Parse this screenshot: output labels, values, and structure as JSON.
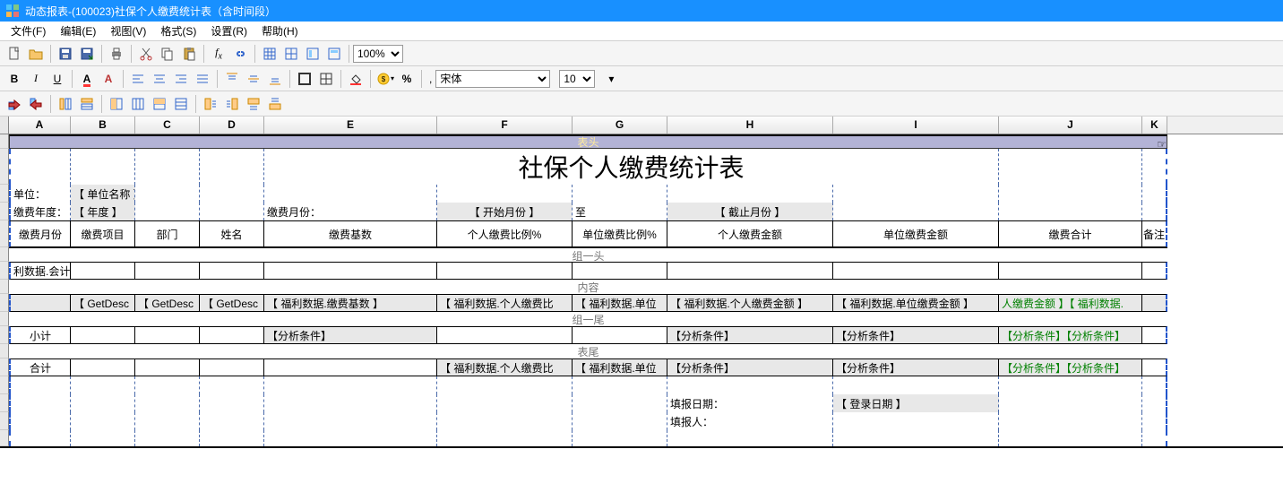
{
  "title": "动态报表-(100023)社保个人缴费统计表（含时间段）",
  "menu": [
    "文件(F)",
    "编辑(E)",
    "视图(V)",
    "格式(S)",
    "设置(R)",
    "帮助(H)"
  ],
  "zoom": "100%",
  "fontName": "宋体",
  "fontSize": "10",
  "comma": ",",
  "columns": [
    "A",
    "B",
    "C",
    "D",
    "E",
    "F",
    "G",
    "H",
    "I",
    "J",
    "K"
  ],
  "widths": [
    "cA",
    "cB",
    "cC",
    "cD",
    "cE",
    "cF",
    "cG",
    "cH",
    "cI",
    "cJ",
    "cK"
  ],
  "sections": {
    "head": "表头",
    "g1head": "组一头",
    "content": "内容",
    "g1foot": "组一尾",
    "foot": "表尾"
  },
  "docTitle": "社保个人缴费统计表",
  "labels": {
    "unit": "单位：",
    "unitName": "【 单位名称 】",
    "year": "缴费年度：",
    "yearVal": "【 年度 】",
    "month": "缴费月份：",
    "monthStart": "【 开始月份 】",
    "to": "至",
    "monthEnd": "【 截止月份 】"
  },
  "headers": {
    "A": "缴费月份",
    "B": "缴费项目",
    "C": "部门",
    "D": "姓名",
    "E": "缴费基数",
    "F": "个人缴费比例%",
    "G": "单位缴费比例%",
    "H": "个人缴费金额",
    "I": "单位缴费金额",
    "J": "缴费合计",
    "K": "备注"
  },
  "group1": {
    "A": "利数据.会计"
  },
  "content": {
    "B": "【 GetDesc",
    "C": "【 GetDesc",
    "D": "【 GetDesc",
    "E": "【 福利数据.缴费基数 】",
    "F": "【 福利数据.个人缴费比",
    "G": "【 福利数据.单位",
    "H": "【 福利数据.个人缴费金额 】",
    "I": "【 福利数据.单位缴费金额 】",
    "J": "人缴费金额 】【 福利数据."
  },
  "subtotal": {
    "A": "小计",
    "E": "【分析条件】",
    "H": "【分析条件】",
    "I": "【分析条件】",
    "J": "【分析条件】【分析条件】"
  },
  "total": {
    "A": "合计",
    "F": "【 福利数据.个人缴费比",
    "G": "【 福利数据.单位",
    "H": "【分析条件】",
    "I": "【分析条件】",
    "J": "【分析条件】【分析条件】"
  },
  "footer": {
    "fillDate": "填报日期：",
    "fillDateVal": "【 登录日期 】",
    "filler": "填报人："
  }
}
